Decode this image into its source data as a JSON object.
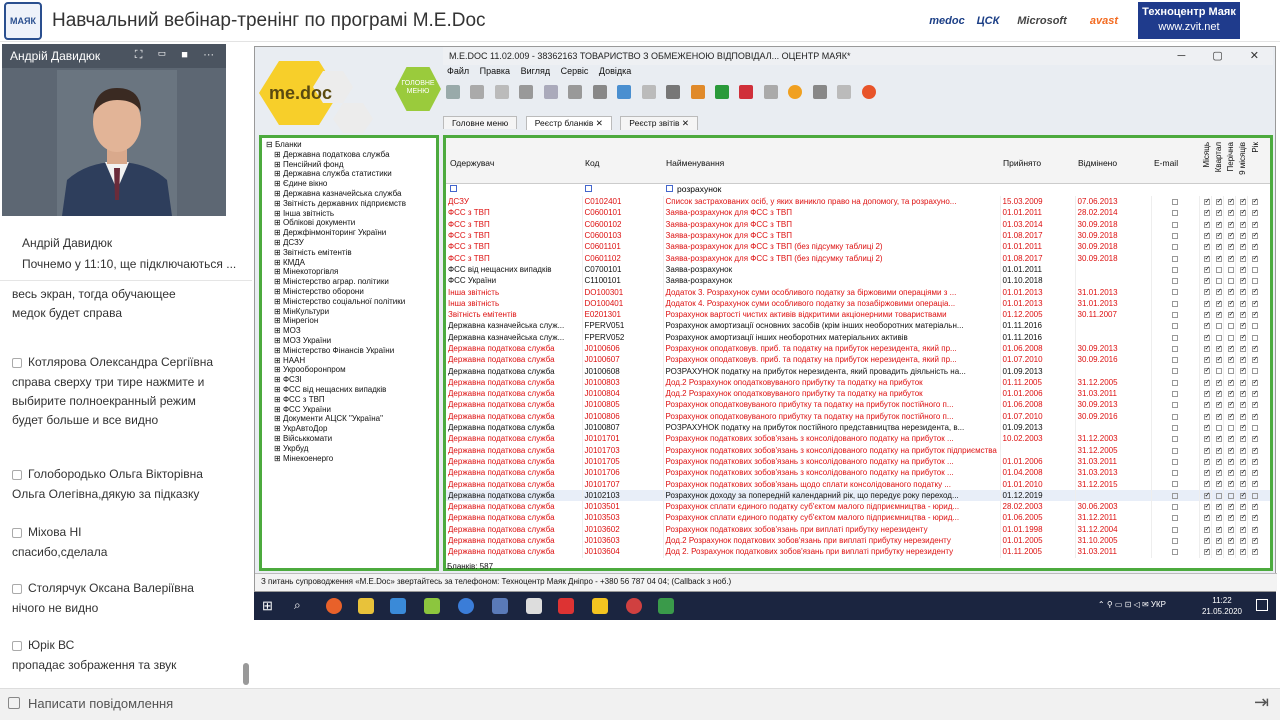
{
  "header": {
    "title": "Навчальний вебінар-тренінг по програмі M.E.Doc",
    "logo_text": "МАЯК",
    "partners": [
      "medoc",
      "ЦСК",
      "Microsoft",
      "avast"
    ],
    "mayak_name": "Техноцентр Маяк",
    "mayak_url": "www.zvit.net"
  },
  "video": {
    "presenter": "Андрій Давидюк"
  },
  "chat": {
    "pinned_name": "Андрій Давидюк",
    "pinned_text": "Почнемо у 11:10, ще підключаються ...",
    "first_text": "весь экран, тогда обучающее медок будет справа",
    "messages": [
      {
        "name": "Котлярова Олександра Сергіївна",
        "text": "справа сверху три тире нажмите и выбирите полноекранный режим будет больше и все видно"
      },
      {
        "name": "Голобородько Ольга Вікторівна",
        "text": "Ольга Олегівна,дякую за підказку"
      },
      {
        "name": "Міхова НІ",
        "text": "спасибо,сделала"
      },
      {
        "name": "Столярчук Оксана Валеріївна",
        "text": "нічого не видно"
      },
      {
        "name": "Юрік ВС",
        "text": "пропадає зображення та звук"
      }
    ],
    "input_placeholder": "Написати повідомлення"
  },
  "app": {
    "title": "M.E.DOC 11.02.009 - 38362163 ТОВАРИСТВО З ОБМЕЖЕНОЮ ВІДПОВІДАЛ... ОЦЕНТР МАЯК*",
    "menu": [
      "Файл",
      "Правка",
      "Вигляд",
      "Сервіс",
      "Довідка"
    ],
    "tabs": [
      "Головне меню",
      "Реєстр бланків",
      "Реєстр звітів"
    ],
    "main_menu_label": "ГОЛОВНЕ МЕНЮ",
    "logo_text": "me.doc",
    "tree_root": "Бланки",
    "tree": [
      "Державна податкова служба",
      "Пенсійний фонд",
      "Державна служба статистики",
      "Єдине вікно",
      "Державна казначейська служба",
      "Звітність державних підприємств",
      "Інша звітність",
      "Облікові документи",
      "Держфінмоніторинг України",
      "ДСЗУ",
      "Звітність емітентів",
      "КМДА",
      "Мінекоторгівля",
      "Міністерство аграр. політики",
      "Міністерство оборони",
      "Міністерство соціальної політики",
      "МінКультури",
      "Мінрегіон",
      "МОЗ",
      "МОЗ України",
      "Міністерство Фінансів України",
      "НААН",
      "Укрооборонпром",
      "ФСЗІ",
      "ФСС від нещасних випадків",
      "ФСС з ТВП",
      "ФСС України",
      "Документи АЦСК \"Україна\"",
      "УкрАвтоДор",
      "Військкомати",
      "Укрбуд",
      "Мінекоенерго"
    ],
    "columns": [
      "Одержувач",
      "Код",
      "Найменування",
      "Прийнято",
      "Відмінено",
      "E-mail",
      "Місяць",
      "Квартал",
      "Перічна",
      "9 місяців",
      "Рік"
    ],
    "filter_text": "розрахунок",
    "rows": [
      {
        "r": "ДСЗУ",
        "c": "C0102401",
        "n": "Список застрахованих осіб, у яких виникло право на допомогу, та розрахуно...",
        "p": "15.03.2009",
        "v": "07.06.2013",
        "red": true
      },
      {
        "r": "ФСС з ТВП",
        "c": "C0600101",
        "n": "Заява-розрахунок для ФСС з ТВП",
        "p": "01.01.2011",
        "v": "28.02.2014",
        "red": true
      },
      {
        "r": "ФСС з ТВП",
        "c": "C0600102",
        "n": "Заява-розрахунок для ФСС з ТВП",
        "p": "01.03.2014",
        "v": "30.09.2018",
        "red": true
      },
      {
        "r": "ФСС з ТВП",
        "c": "C0600103",
        "n": "Заява-розрахунок для ФСС з ТВП",
        "p": "01.08.2017",
        "v": "30.09.2018",
        "red": true
      },
      {
        "r": "ФСС з ТВП",
        "c": "C0601101",
        "n": "Заява-розрахунок для ФСС з ТВП (без підсумку таблиці 2)",
        "p": "01.01.2011",
        "v": "30.09.2018",
        "red": true
      },
      {
        "r": "ФСС з ТВП",
        "c": "C0601102",
        "n": "Заява-розрахунок для ФСС з ТВП (без підсумку таблиці 2)",
        "p": "01.08.2017",
        "v": "30.09.2018",
        "red": true
      },
      {
        "r": "ФСС від нещасних випадків",
        "c": "C0700101",
        "n": "Заява-розрахунок",
        "p": "01.01.2011",
        "v": "",
        "red": false
      },
      {
        "r": "ФСС України",
        "c": "C1100101",
        "n": "Заява-розрахунок",
        "p": "01.10.2018",
        "v": "",
        "red": false
      },
      {
        "r": "Інша звітність",
        "c": "DO100301",
        "n": "Додаток 3. Розрахунок суми особливого податку за біржовими операціями з ...",
        "p": "01.01.2013",
        "v": "31.01.2013",
        "red": true
      },
      {
        "r": "Інша звітність",
        "c": "DO100401",
        "n": "Додаток 4. Розрахунок суми особливого податку за позабіржовими операціа...",
        "p": "01.01.2013",
        "v": "31.01.2013",
        "red": true
      },
      {
        "r": "Звітність емітентів",
        "c": "E0201301",
        "n": "Розрахунок вартості чистих активів відкритими акціонерними товариствами",
        "p": "01.12.2005",
        "v": "30.11.2007",
        "red": true
      },
      {
        "r": "Державна казначейська служ...",
        "c": "FPERV051",
        "n": "Розрахунок амортизації основних засобів (крім інших необоротних матеріальн...",
        "p": "01.11.2016",
        "v": "",
        "red": false
      },
      {
        "r": "Державна казначейська служ...",
        "c": "FPERV052",
        "n": "Розрахунок амортизації інших необоротних матеріальних активів",
        "p": "01.11.2016",
        "v": "",
        "red": false
      },
      {
        "r": "Державна податкова служба",
        "c": "J0100606",
        "n": "Розрахунок оподатковув. приб. та податку на прибуток нерезидента, який пр...",
        "p": "01.06.2008",
        "v": "30.09.2013",
        "red": true
      },
      {
        "r": "Державна податкова служба",
        "c": "J0100607",
        "n": "Розрахунок оподатковув. приб. та податку на прибуток нерезидента, який пр...",
        "p": "01.07.2010",
        "v": "30.09.2016",
        "red": true
      },
      {
        "r": "Державна податкова служба",
        "c": "J0100608",
        "n": "РОЗРАХУНОК податку на прибуток нерезидента, який провадить діяльність на...",
        "p": "01.09.2013",
        "v": "",
        "red": false
      },
      {
        "r": "Державна податкова служба",
        "c": "J0100803",
        "n": "Дод.2 Розрахунок оподатковуваного прибутку та податку на прибуток",
        "p": "01.11.2005",
        "v": "31.12.2005",
        "red": true
      },
      {
        "r": "Державна податкова служба",
        "c": "J0100804",
        "n": "Дод.2 Розрахунок оподатковуваного прибутку та податку на прибуток",
        "p": "01.01.2006",
        "v": "31.03.2011",
        "red": true
      },
      {
        "r": "Державна податкова служба",
        "c": "J0100805",
        "n": "Розрахунок оподатковуваного прибутку та податку на прибуток постійного п...",
        "p": "01.06.2008",
        "v": "30.09.2013",
        "red": true
      },
      {
        "r": "Державна податкова служба",
        "c": "J0100806",
        "n": "Розрахунок оподатковуваного прибутку та податку на прибуток постійного п...",
        "p": "01.07.2010",
        "v": "30.09.2016",
        "red": true
      },
      {
        "r": "Державна податкова служба",
        "c": "J0100807",
        "n": "РОЗРАХУНОК податку на прибуток постійного представництва нерезидента, в...",
        "p": "01.09.2013",
        "v": "",
        "red": false
      },
      {
        "r": "Державна податкова служба",
        "c": "J0101701",
        "n": "Розрахунок податкових зобов'язань з консолідованого податку на прибуток ...",
        "p": "10.02.2003",
        "v": "31.12.2003",
        "red": true
      },
      {
        "r": "Державна податкова служба",
        "c": "J0101703",
        "n": "Розрахунок податкових зобов'язань з консолідованого податку на прибуток підприємства",
        "p": "",
        "v": "31.12.2005",
        "red": true
      },
      {
        "r": "Державна податкова служба",
        "c": "J0101705",
        "n": "Розрахунок податкових зобов'язань з консолідованого податку на прибуток ...",
        "p": "01.01.2006",
        "v": "31.03.2011",
        "red": true
      },
      {
        "r": "Державна податкова служба",
        "c": "J0101706",
        "n": "Розрахунок податкових зобов'язань з консолідованого податку на прибуток ...",
        "p": "01.04.2008",
        "v": "31.03.2013",
        "red": true
      },
      {
        "r": "Державна податкова служба",
        "c": "J0101707",
        "n": "Розрахунок податкових зобов'язань щодо сплати консолідованого податку ...",
        "p": "01.01.2010",
        "v": "31.12.2015",
        "red": true
      },
      {
        "r": "Державна податкова служба",
        "c": "J0102103",
        "n": "Розрахунок доходу за попередній календарний рік, що передує року переход...",
        "p": "01.12.2019",
        "v": "",
        "red": false
      },
      {
        "r": "Державна податкова служба",
        "c": "J0103501",
        "n": "Розрахунок сплати єдиного податку суб'єктом малого підприємництва - юрид...",
        "p": "28.02.2003",
        "v": "30.06.2003",
        "red": true
      },
      {
        "r": "Державна податкова служба",
        "c": "J0103503",
        "n": "Розрахунок сплати єдиного податку суб'єктом малого підприємництва - юрид...",
        "p": "01.06.2005",
        "v": "31.12.2011",
        "red": true
      },
      {
        "r": "Державна податкова служба",
        "c": "J0103602",
        "n": "Розрахунок податкових зобов'язань при виплаті прибутку нерезиденту",
        "p": "01.01.1998",
        "v": "31.12.2004",
        "red": true
      },
      {
        "r": "Державна податкова служба",
        "c": "J0103603",
        "n": "Дод.2 Розрахунок податкових зобов'язань при виплаті прибутку нерезиденту",
        "p": "01.01.2005",
        "v": "31.10.2005",
        "red": true
      },
      {
        "r": "Державна податкова служба",
        "c": "J0103604",
        "n": "Дод 2. Розрахунок податкових зобов'язань при виплаті прибутку нерезиденту",
        "p": "01.11.2005",
        "v": "31.03.2011",
        "red": true
      }
    ],
    "blanks_count": "Бланків: 587",
    "status": "З питань супроводження «M.E.Doc» звертайтесь за телефоном: Техноцентр Маяк Дніпро - +380 56 787 04 04; (Callback з ноб.)"
  },
  "taskbar": {
    "lang": "УКР",
    "time": "11:22",
    "date": "21.05.2020"
  }
}
